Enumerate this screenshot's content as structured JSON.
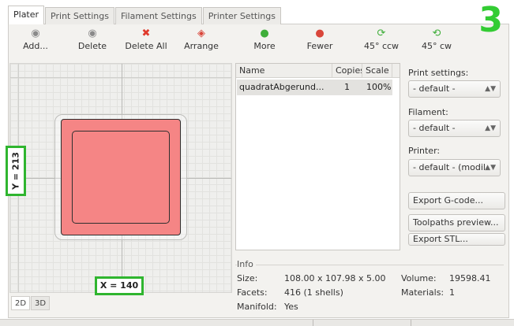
{
  "tabs": [
    {
      "label": "Plater"
    },
    {
      "label": "Print Settings"
    },
    {
      "label": "Filament Settings"
    },
    {
      "label": "Printer Settings"
    }
  ],
  "step_number": "3",
  "toolbar": {
    "add": {
      "label": "Add...",
      "icon": "add-object-icon"
    },
    "delete": {
      "label": "Delete",
      "icon": "delete-object-icon"
    },
    "delete_all": {
      "label": "Delete All",
      "icon": "red-x-icon"
    },
    "arrange": {
      "label": "Arrange",
      "icon": "arrange-icon"
    },
    "more": {
      "label": "More",
      "icon": "green-plus-icon"
    },
    "fewer": {
      "label": "Fewer",
      "icon": "red-minus-icon"
    },
    "rotate_ccw": {
      "label": "45° ccw",
      "icon": "rotate-ccw-icon"
    },
    "rotate_cw": {
      "label": "45° cw",
      "icon": "rotate-cw-icon"
    }
  },
  "plater": {
    "coord_y": "Y = 213",
    "coord_x": "X = 140",
    "view_tabs": [
      "2D",
      "3D"
    ],
    "object_color": "#f58585"
  },
  "object_list": {
    "columns": [
      "Name",
      "Copies",
      "Scale"
    ],
    "rows": [
      {
        "name": "quadratAbgerund...",
        "copies": "1",
        "scale": "100%"
      }
    ]
  },
  "settings": {
    "print_label": "Print settings:",
    "print_value": "- default -",
    "filament_label": "Filament:",
    "filament_value": "- default -",
    "printer_label": "Printer:",
    "printer_value": "- default - (modil"
  },
  "actions": {
    "export_gcode": "Export G-code...",
    "toolpaths_preview": "Toolpaths preview...",
    "export_stl": "Export STL..."
  },
  "info": {
    "title": "Info",
    "size_label": "Size:",
    "size_value": "108.00 x 107.98 x 5.00",
    "volume_label": "Volume:",
    "volume_value": "19598.41",
    "facets_label": "Facets:",
    "facets_value": "416 (1 shells)",
    "materials_label": "Materials:",
    "materials_value": "1",
    "manifold_label": "Manifold:",
    "manifold_value": "Yes"
  },
  "colors": {
    "highlight_green": "#2fb52f",
    "accent_red": "#e03a2c"
  }
}
